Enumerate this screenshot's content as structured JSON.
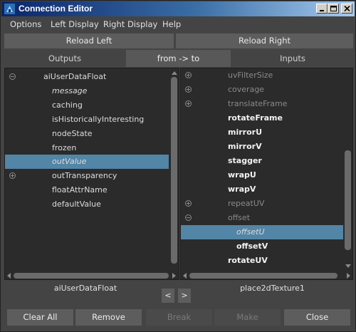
{
  "window": {
    "title": "Connection Editor"
  },
  "menu": [
    "Options",
    "Left Display",
    "Right Display",
    "Help"
  ],
  "reload": {
    "left": "Reload Left",
    "right": "Reload Right"
  },
  "tabs": {
    "outputs": "Outputs",
    "direction": "from -> to",
    "inputs": "Inputs"
  },
  "left_panel": {
    "node": "aiUserDataFloat",
    "items": [
      {
        "label": "aiUserDataFloat",
        "expander": "minus",
        "style": "normal"
      },
      {
        "label": "message",
        "style": "italic"
      },
      {
        "label": "caching",
        "style": "normal"
      },
      {
        "label": "isHistoricallyInteresting",
        "style": "normal"
      },
      {
        "label": "nodeState",
        "style": "normal"
      },
      {
        "label": "frozen",
        "style": "normal"
      },
      {
        "label": "outValue",
        "style": "italic",
        "selected": true
      },
      {
        "label": "outTransparency",
        "expander": "plus",
        "style": "normal"
      },
      {
        "label": "floatAttrName",
        "style": "normal"
      },
      {
        "label": "defaultValue",
        "style": "normal"
      }
    ]
  },
  "right_panel": {
    "node": "place2dTexture1",
    "items": [
      {
        "label": "uvFilterSize",
        "expander": "plus",
        "style": "dim"
      },
      {
        "label": "coverage",
        "expander": "plus",
        "style": "dim"
      },
      {
        "label": "translateFrame",
        "expander": "plus",
        "style": "dim"
      },
      {
        "label": "rotateFrame",
        "style": "bold"
      },
      {
        "label": "mirrorU",
        "style": "bold"
      },
      {
        "label": "mirrorV",
        "style": "bold"
      },
      {
        "label": "stagger",
        "style": "bold"
      },
      {
        "label": "wrapU",
        "style": "bold"
      },
      {
        "label": "wrapV",
        "style": "bold"
      },
      {
        "label": "repeatUV",
        "expander": "plus",
        "style": "dim"
      },
      {
        "label": "offset",
        "expander": "minus",
        "style": "dim"
      },
      {
        "label": "offsetU",
        "style": "italic",
        "indent": true,
        "selected": true
      },
      {
        "label": "offsetV",
        "style": "bold",
        "indent": true
      },
      {
        "label": "rotateUV",
        "style": "bold"
      }
    ]
  },
  "nav": {
    "prev": "<",
    "next": ">"
  },
  "buttons": {
    "clear_all": "Clear All",
    "remove": "Remove",
    "break": "Break",
    "make": "Make",
    "close": "Close"
  }
}
